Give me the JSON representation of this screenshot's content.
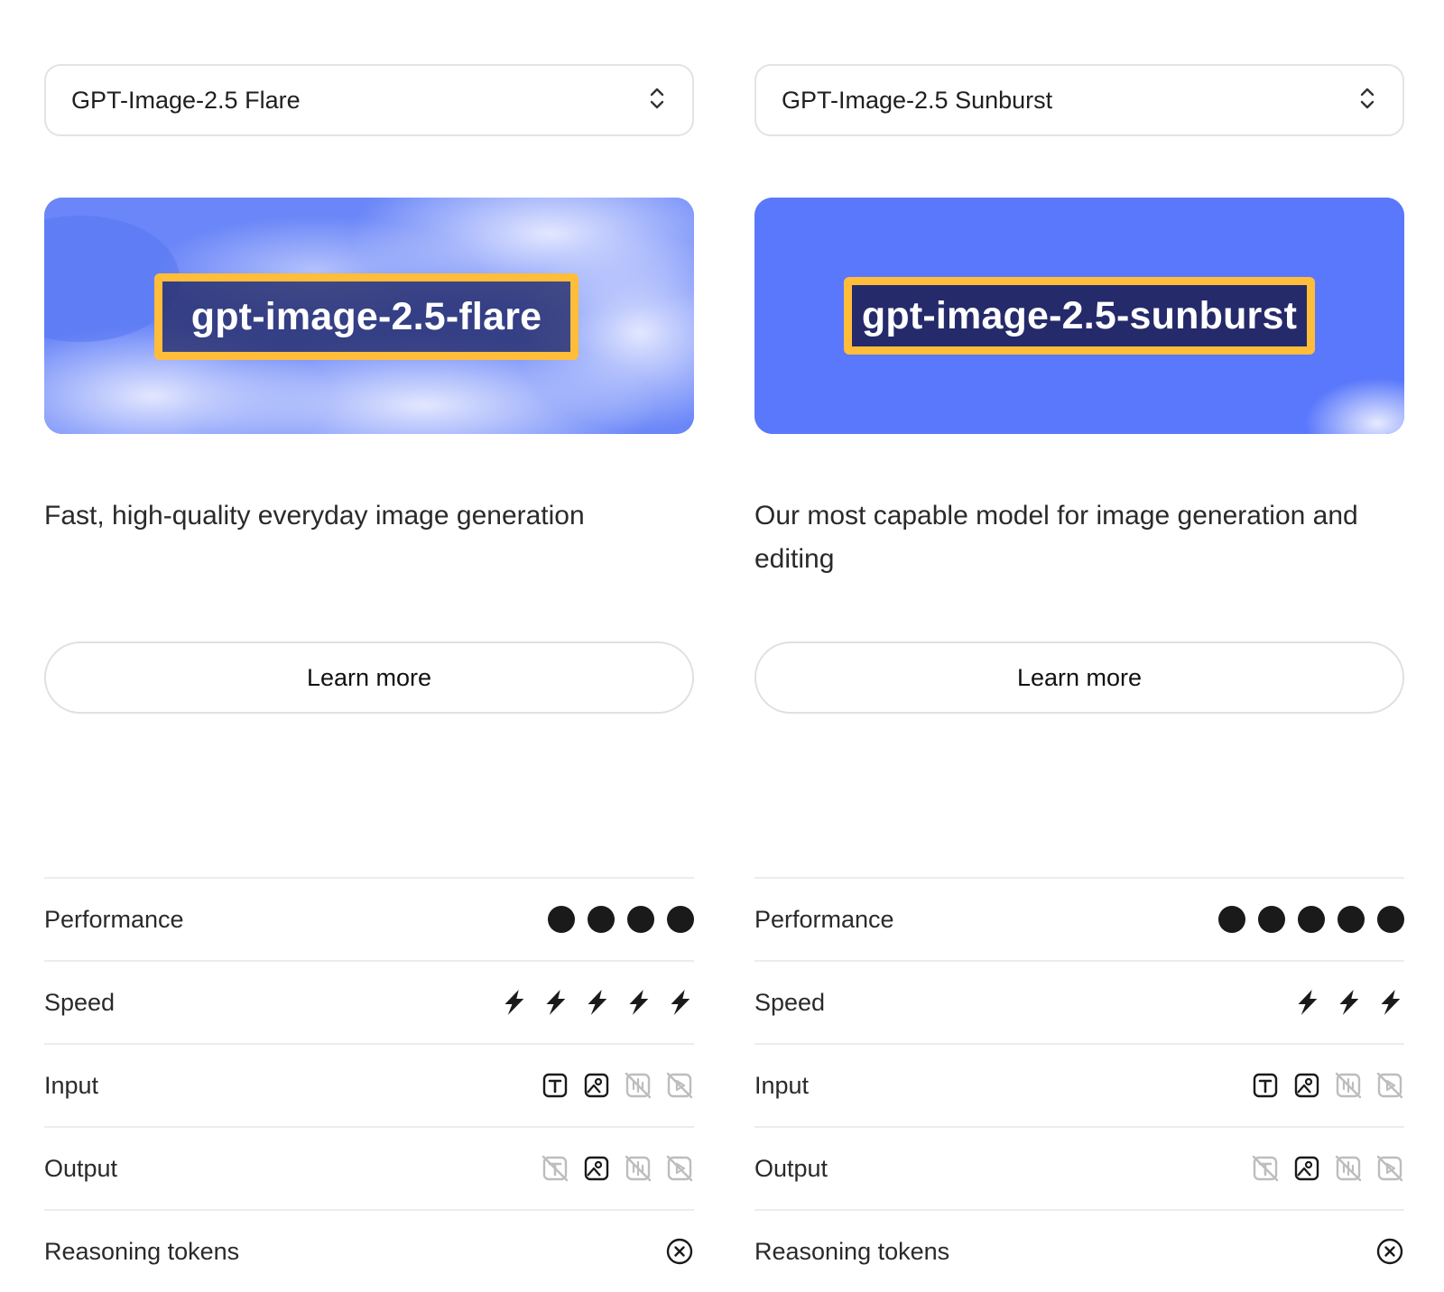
{
  "models": [
    {
      "selector_label": "GPT-Image-2.5 Flare",
      "banner_tag": "gpt-image-2.5-flare",
      "description": "Fast, high-quality everyday image generation",
      "learn_more": "Learn more",
      "specs": {
        "performance": {
          "label": "Performance",
          "rating": 4
        },
        "speed": {
          "label": "Speed",
          "rating": 5
        },
        "input": {
          "label": "Input",
          "modalities": [
            {
              "icon": "text-icon",
              "supported": true
            },
            {
              "icon": "image-icon",
              "supported": true
            },
            {
              "icon": "audio-icon",
              "supported": false
            },
            {
              "icon": "video-icon",
              "supported": false
            }
          ]
        },
        "output": {
          "label": "Output",
          "modalities": [
            {
              "icon": "text-icon",
              "supported": false
            },
            {
              "icon": "image-icon",
              "supported": true
            },
            {
              "icon": "audio-icon",
              "supported": false
            },
            {
              "icon": "video-icon",
              "supported": false
            }
          ]
        },
        "reasoning": {
          "label": "Reasoning tokens",
          "supported": false
        }
      }
    },
    {
      "selector_label": "GPT-Image-2.5 Sunburst",
      "banner_tag": "gpt-image-2.5-sunburst",
      "description": "Our most capable model for image generation and editing",
      "learn_more": "Learn more",
      "specs": {
        "performance": {
          "label": "Performance",
          "rating": 5
        },
        "speed": {
          "label": "Speed",
          "rating": 3
        },
        "input": {
          "label": "Input",
          "modalities": [
            {
              "icon": "text-icon",
              "supported": true
            },
            {
              "icon": "image-icon",
              "supported": true
            },
            {
              "icon": "audio-icon",
              "supported": false
            },
            {
              "icon": "video-icon",
              "supported": false
            }
          ]
        },
        "output": {
          "label": "Output",
          "modalities": [
            {
              "icon": "text-icon",
              "supported": false
            },
            {
              "icon": "image-icon",
              "supported": true
            },
            {
              "icon": "audio-icon",
              "supported": false
            },
            {
              "icon": "video-icon",
              "supported": false
            }
          ]
        },
        "reasoning": {
          "label": "Reasoning tokens",
          "supported": false
        }
      }
    }
  ],
  "colors": {
    "banner_blue": "#5b7bff",
    "tag_border": "#ffbd3a",
    "tag_fill": "#252a6a",
    "icon_dark": "#1a1a1a",
    "icon_disabled": "#bdbdbd"
  }
}
